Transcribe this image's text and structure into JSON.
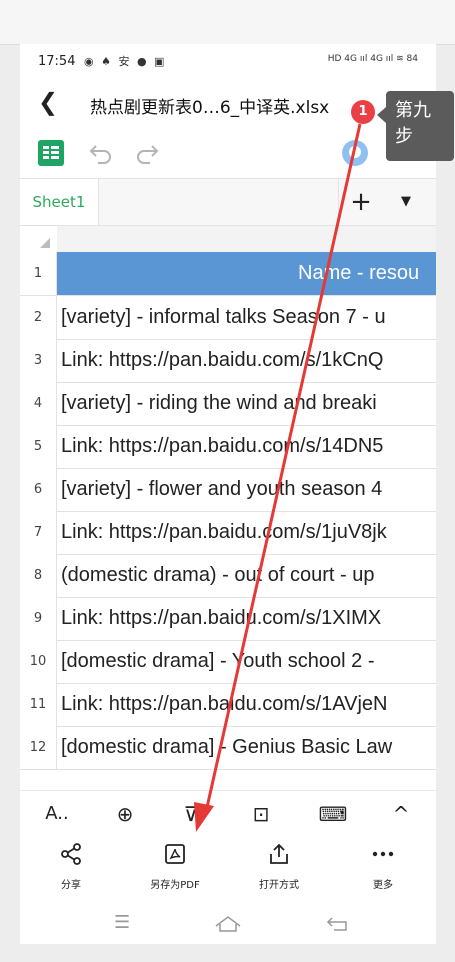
{
  "status": {
    "time": "17:54",
    "notif_icons": "◉ ♠ 安 ● ▣",
    "right_icons": "HD 4G ııl 4G ııl ≋ 84"
  },
  "title": {
    "doc_name": "热点剧更新表0…6_中译英.xlsx"
  },
  "sheet_tab": {
    "name": "Sheet1",
    "add_label": "+",
    "more_label": "▼"
  },
  "header_row": {
    "num": "1",
    "text": "Name - resou"
  },
  "rows": [
    {
      "num": "2",
      "text": "[variety] - informal talks Season 7 - u"
    },
    {
      "num": "3",
      "text": "Link: https://pan.baidu.com/s/1kCnQ"
    },
    {
      "num": "4",
      "text": "[variety] - riding the wind and breaki"
    },
    {
      "num": "5",
      "text": "Link: https://pan.baidu.com/s/14DN5"
    },
    {
      "num": "6",
      "text": "[variety] - flower and youth season 4"
    },
    {
      "num": "7",
      "text": "Link: https://pan.baidu.com/s/1juV8jk"
    },
    {
      "num": "8",
      "text": "(domestic drama) - out of court - up"
    },
    {
      "num": "9",
      "text": "Link: https://pan.baidu.com/s/1XIMX"
    },
    {
      "num": "10",
      "text": "[domestic drama] - Youth school 2 -"
    },
    {
      "num": "11",
      "text": "Link: https://pan.baidu.com/s/1AVjeN"
    },
    {
      "num": "12",
      "text": "[domestic drama] - Genius Basic Law"
    }
  ],
  "bottom_tools": [
    "A..",
    "⊕",
    "⊽",
    "⊡",
    "⌨",
    "^"
  ],
  "actions": [
    {
      "icon": "share-icon",
      "label": "分享"
    },
    {
      "icon": "pdf-icon",
      "label": "另存为PDF"
    },
    {
      "icon": "open-with-icon",
      "label": "打开方式"
    },
    {
      "icon": "more-icon",
      "label": "更多"
    }
  ],
  "overlay": {
    "badge": "1",
    "callout": "第九步",
    "callout_line1": "第九",
    "callout_line2": "步",
    "accent": "#e94045"
  },
  "colors": {
    "header_fill": "#5a95d4",
    "sheet_tab_text": "#2ea85c"
  }
}
